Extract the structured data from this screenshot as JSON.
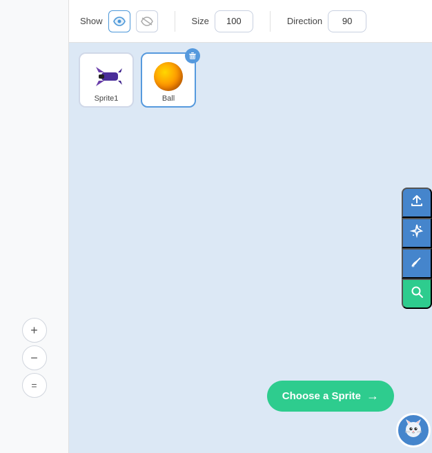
{
  "toolbar": {
    "show_label": "Show",
    "size_label": "Size",
    "direction_label": "Direction",
    "size_value": "100",
    "direction_value": "90"
  },
  "sprites": [
    {
      "id": "sprite1",
      "name": "Sprite1",
      "type": "plane",
      "selected": false
    },
    {
      "id": "ball",
      "name": "Ball",
      "type": "ball",
      "selected": true
    }
  ],
  "actions": {
    "upload_icon": "⬆",
    "sparkle_icon": "✦",
    "brush_icon": "✏",
    "search_icon": "🔍"
  },
  "choose_sprite": {
    "label": "Choose a Sprite",
    "arrow": "→"
  },
  "zoom": {
    "zoom_in_label": "+",
    "zoom_out_label": "−",
    "fit_label": "="
  }
}
